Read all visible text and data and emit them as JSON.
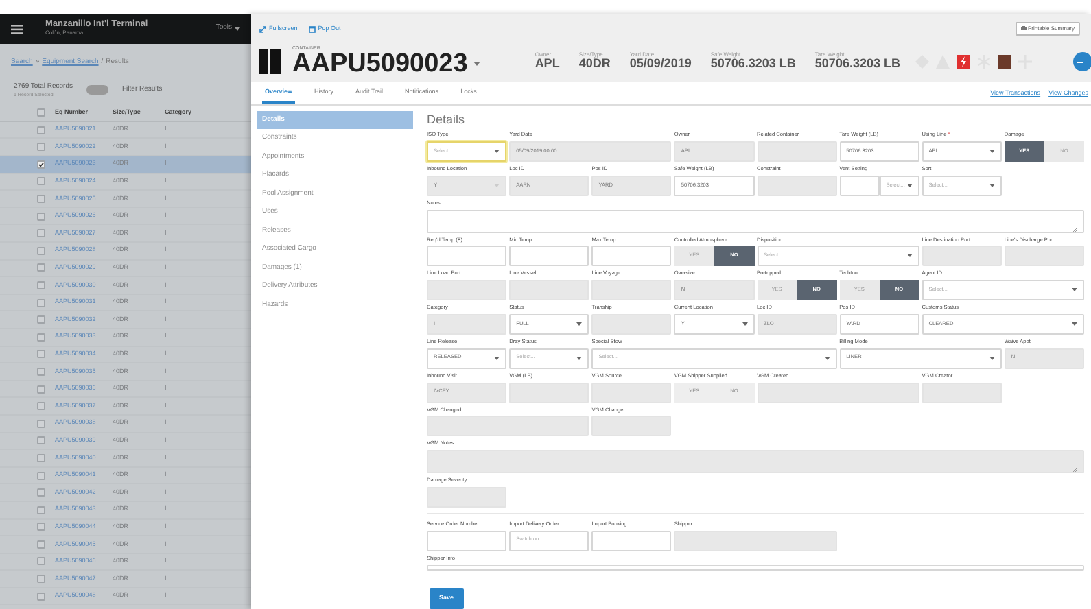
{
  "app": {
    "title": "Manzanillo Int'l Terminal",
    "subtitle": "Colón, Panama",
    "menu": "Tools"
  },
  "breadcrumb": [
    {
      "label": "Search",
      "link": true
    },
    {
      "label": "»",
      "link": false
    },
    {
      "label": "Equipment Search",
      "link": true
    },
    {
      "label": "/",
      "link": false
    },
    {
      "label": "Results",
      "link": false
    }
  ],
  "results": {
    "all_selected": false,
    "total": "2769 Total Records",
    "selected_note": "1 Record Selected",
    "filter": {
      "label": "Filter Results",
      "on": false
    },
    "columns": [
      "Eq Number",
      "Size/Type",
      "Category"
    ],
    "rows": [
      {
        "eq": "AAPU5090021",
        "size": "40DR",
        "category": "I",
        "selected": false
      },
      {
        "eq": "AAPU5090022",
        "size": "40DR",
        "category": "I",
        "selected": false
      },
      {
        "eq": "AAPU5090023",
        "size": "40DR",
        "category": "I",
        "selected": true
      },
      {
        "eq": "AAPU5090024",
        "size": "40DR",
        "category": "I",
        "selected": false
      },
      {
        "eq": "AAPU5090025",
        "size": "40DR",
        "category": "I",
        "selected": false
      },
      {
        "eq": "AAPU5090026",
        "size": "40DR",
        "category": "I",
        "selected": false
      },
      {
        "eq": "AAPU5090027",
        "size": "40DR",
        "category": "I",
        "selected": false
      },
      {
        "eq": "AAPU5090028",
        "size": "40DR",
        "category": "I",
        "selected": false
      },
      {
        "eq": "AAPU5090029",
        "size": "40DR",
        "category": "I",
        "selected": false
      },
      {
        "eq": "AAPU5090030",
        "size": "40DR",
        "category": "I",
        "selected": false
      },
      {
        "eq": "AAPU5090031",
        "size": "40DR",
        "category": "I",
        "selected": false
      },
      {
        "eq": "AAPU5090032",
        "size": "40DR",
        "category": "I",
        "selected": false
      },
      {
        "eq": "AAPU5090033",
        "size": "40DR",
        "category": "I",
        "selected": false
      },
      {
        "eq": "AAPU5090034",
        "size": "40DR",
        "category": "I",
        "selected": false
      },
      {
        "eq": "AAPU5090035",
        "size": "40DR",
        "category": "I",
        "selected": false
      },
      {
        "eq": "AAPU5090036",
        "size": "40DR",
        "category": "I",
        "selected": false
      },
      {
        "eq": "AAPU5090037",
        "size": "40DR",
        "category": "I",
        "selected": false
      },
      {
        "eq": "AAPU5090038",
        "size": "40DR",
        "category": "I",
        "selected": false
      },
      {
        "eq": "AAPU5090039",
        "size": "40DR",
        "category": "I",
        "selected": false
      },
      {
        "eq": "AAPU5090040",
        "size": "40DR",
        "category": "I",
        "selected": false
      },
      {
        "eq": "AAPU5090041",
        "size": "40DR",
        "category": "I",
        "selected": false
      },
      {
        "eq": "AAPU5090042",
        "size": "40DR",
        "category": "I",
        "selected": false
      },
      {
        "eq": "AAPU5090043",
        "size": "40DR",
        "category": "I",
        "selected": false
      },
      {
        "eq": "AAPU5090044",
        "size": "40DR",
        "category": "I",
        "selected": false
      },
      {
        "eq": "AAPU5090045",
        "size": "40DR",
        "category": "I",
        "selected": false
      },
      {
        "eq": "AAPU5090046",
        "size": "40DR",
        "category": "I",
        "selected": false
      },
      {
        "eq": "AAPU5090047",
        "size": "40DR",
        "category": "I",
        "selected": false
      },
      {
        "eq": "AAPU5090048",
        "size": "40DR",
        "category": "I",
        "selected": false
      }
    ]
  },
  "toolbar": {
    "links": [
      "Fullscreen",
      "Pop Out"
    ],
    "print_button": "Printable Summary"
  },
  "header": {
    "type_label": "CONTAINER",
    "number": "AAPU5090023",
    "stats": [
      {
        "label": "Owner",
        "value": "APL"
      },
      {
        "label": "Size/Type",
        "value": "40DR"
      },
      {
        "label": "Yard Date",
        "value": "05/09/2019"
      },
      {
        "label": "Safe Weight",
        "value": "50706.3203 LB"
      },
      {
        "label": "Tare Weight",
        "value": "50706.3203 LB"
      }
    ],
    "flags": [
      {
        "kind": "diamond",
        "on": false
      },
      {
        "kind": "triangle",
        "on": false
      },
      {
        "kind": "bolt",
        "on": true
      },
      {
        "kind": "snowflake",
        "on": false
      },
      {
        "kind": "square",
        "on": true
      },
      {
        "kind": "cross",
        "on": false
      }
    ]
  },
  "tabs": [
    {
      "label": "Overview",
      "selected": true
    },
    {
      "label": "History",
      "selected": false
    },
    {
      "label": "Audit Trail",
      "selected": false
    },
    {
      "label": "Notifications",
      "selected": false
    },
    {
      "label": "Locks",
      "selected": false
    }
  ],
  "tab_links": [
    "View Transactions",
    "View Changes"
  ],
  "side_nav": [
    {
      "label": "Details",
      "selected": true
    },
    {
      "label": "Constraints",
      "selected": false
    },
    {
      "label": "Appointments",
      "selected": false
    },
    {
      "label": "Placards",
      "selected": false
    },
    {
      "label": "Pool Assignment",
      "selected": false
    },
    {
      "label": "Uses",
      "selected": false
    },
    {
      "label": "Releases",
      "selected": false
    },
    {
      "label": "Associated Cargo",
      "selected": false
    },
    {
      "label": "Damages (1)",
      "selected": false
    },
    {
      "label": "Delivery Attributes",
      "selected": false
    },
    {
      "label": "Hazards",
      "selected": false
    }
  ],
  "section_title": "Details",
  "form_rows": [
    {
      "fields": [
        {
          "label": "ISO Type",
          "kind": "select",
          "placeholder": "Select...",
          "focused": true
        },
        {
          "label": "Yard Date",
          "kind": "input",
          "value": "05/09/2019 00:00",
          "disabled": true
        },
        {
          "label": "Owner",
          "kind": "input",
          "value": "APL",
          "disabled": true
        },
        {
          "label": "Related Container",
          "kind": "input",
          "disabled": true
        },
        {
          "label": "Tare Weight (LB)",
          "kind": "input",
          "value": "50706.3203"
        },
        {
          "label": "Using Line",
          "required_mark": "*",
          "kind": "select",
          "value": "APL"
        },
        {
          "label": "Damage",
          "kind": "toggle",
          "options": [
            {
              "label": "YES",
              "selected": true
            },
            {
              "label": "NO",
              "selected": false
            }
          ]
        }
      ]
    },
    {
      "fields": [
        {
          "label": "Inbound Location",
          "kind": "select",
          "value": "Y",
          "disabled": true
        },
        {
          "label": "Loc ID",
          "kind": "input",
          "value": "AARN",
          "disabled": true
        },
        {
          "label": "Pos ID",
          "kind": "input",
          "value": "YARD",
          "disabled": true
        },
        {
          "label": "Safe Weight (LB)",
          "kind": "input",
          "value": "50706.3203"
        },
        {
          "label": "Constraint",
          "kind": "input",
          "disabled": true
        },
        {
          "label": "Vent Setting",
          "kind": "combo",
          "placeholder": "Select..."
        },
        {
          "label": "Sort",
          "kind": "select",
          "placeholder": "Select..."
        }
      ]
    },
    {
      "fields": [
        {
          "label": "Notes",
          "kind": "textarea"
        }
      ]
    },
    {
      "fields": [
        {
          "label": "Req'd Temp (F)",
          "kind": "input"
        },
        {
          "label": "Min Temp",
          "kind": "input"
        },
        {
          "label": "Max Temp",
          "kind": "input"
        },
        {
          "label": "Controlled Atmosphere",
          "kind": "toggle",
          "options": [
            {
              "label": "YES",
              "selected": false
            },
            {
              "label": "NO",
              "selected": true
            }
          ]
        },
        {
          "label": "Disposition",
          "kind": "select",
          "placeholder": "Select..."
        },
        {
          "label": "Line Destination Port",
          "kind": "input",
          "disabled": true
        },
        {
          "label": "Line's Discharge Port",
          "kind": "input",
          "disabled": true
        }
      ]
    },
    {
      "fields": [
        {
          "label": "Line Load Port",
          "kind": "input",
          "disabled": true
        },
        {
          "label": "Line Vessel",
          "kind": "input",
          "disabled": true
        },
        {
          "label": "Line Voyage",
          "kind": "input",
          "disabled": true
        },
        {
          "label": "Oversize",
          "kind": "input",
          "value": "N",
          "disabled": true
        },
        {
          "label": "Pretripped",
          "kind": "toggle",
          "options": [
            {
              "label": "YES",
              "selected": false
            },
            {
              "label": "NO",
              "selected": true
            }
          ]
        },
        {
          "label": "Techtool",
          "kind": "toggle",
          "options": [
            {
              "label": "YES",
              "selected": false
            },
            {
              "label": "NO",
              "selected": true
            }
          ]
        },
        {
          "label": "Agent ID",
          "kind": "select",
          "placeholder": "Select..."
        }
      ]
    },
    {
      "fields": [
        {
          "label": "Category",
          "kind": "input",
          "value": "I",
          "disabled": true
        },
        {
          "label": "Status",
          "kind": "select",
          "value": "FULL"
        },
        {
          "label": "Tranship",
          "kind": "input",
          "disabled": true
        },
        {
          "label": "Current Location",
          "kind": "select",
          "value": "Y"
        },
        {
          "label": "Loc ID",
          "kind": "input",
          "value": "ZLO",
          "disabled": true
        },
        {
          "label": "Pos ID",
          "kind": "input",
          "value": "YARD"
        },
        {
          "label": "Customs Status",
          "kind": "select",
          "value": "CLEARED"
        }
      ]
    },
    {
      "fields": [
        {
          "label": "Line Release",
          "kind": "select",
          "value": "RELEASED"
        },
        {
          "label": "Dray Status",
          "kind": "select",
          "placeholder": "Select..."
        },
        {
          "label": "Special Stow",
          "kind": "select",
          "placeholder": "Select..."
        },
        {
          "label": "Billing Mode",
          "kind": "select",
          "value": "LINER"
        },
        {
          "label": "Waive Appt",
          "kind": "input",
          "value": "N",
          "disabled": true
        }
      ]
    },
    {
      "fields": [
        {
          "label": "Inbound Visit",
          "kind": "input",
          "value": "IVCEY",
          "disabled": true
        },
        {
          "label": "VGM (LB)",
          "kind": "input",
          "disabled": true
        },
        {
          "label": "VGM Source",
          "kind": "input",
          "disabled": true
        },
        {
          "label": "VGM Shipper Supplied",
          "kind": "toggle",
          "disabled": true,
          "options": [
            {
              "label": "YES",
              "selected": false
            },
            {
              "label": "NO",
              "selected": false
            }
          ]
        },
        {
          "label": "VGM Created",
          "kind": "input",
          "disabled": true
        },
        {
          "label": "VGM Creator",
          "kind": "input",
          "disabled": true
        }
      ]
    },
    {
      "fields": [
        {
          "label": "VGM Changed",
          "kind": "input",
          "disabled": true
        },
        {
          "label": "VGM Changer",
          "kind": "input",
          "disabled": true
        }
      ]
    },
    {
      "fields": [
        {
          "label": "VGM Notes",
          "kind": "textarea",
          "disabled": true
        }
      ]
    },
    {
      "fields": [
        {
          "label": "Damage Severity",
          "kind": "input",
          "disabled": true
        }
      ]
    },
    {
      "divider": true,
      "fields": [
        {
          "label": "Service Order Number",
          "kind": "input"
        },
        {
          "label": "Import Delivery Order",
          "kind": "input",
          "placeholder": "Switch on"
        },
        {
          "label": "Import Booking",
          "kind": "input"
        },
        {
          "label": "Shipper",
          "kind": "input",
          "disabled": true
        }
      ]
    },
    {
      "fields": [
        {
          "label": "Shipper Info",
          "kind": "textarea",
          "short": true
        }
      ]
    }
  ],
  "save_button": "Save"
}
